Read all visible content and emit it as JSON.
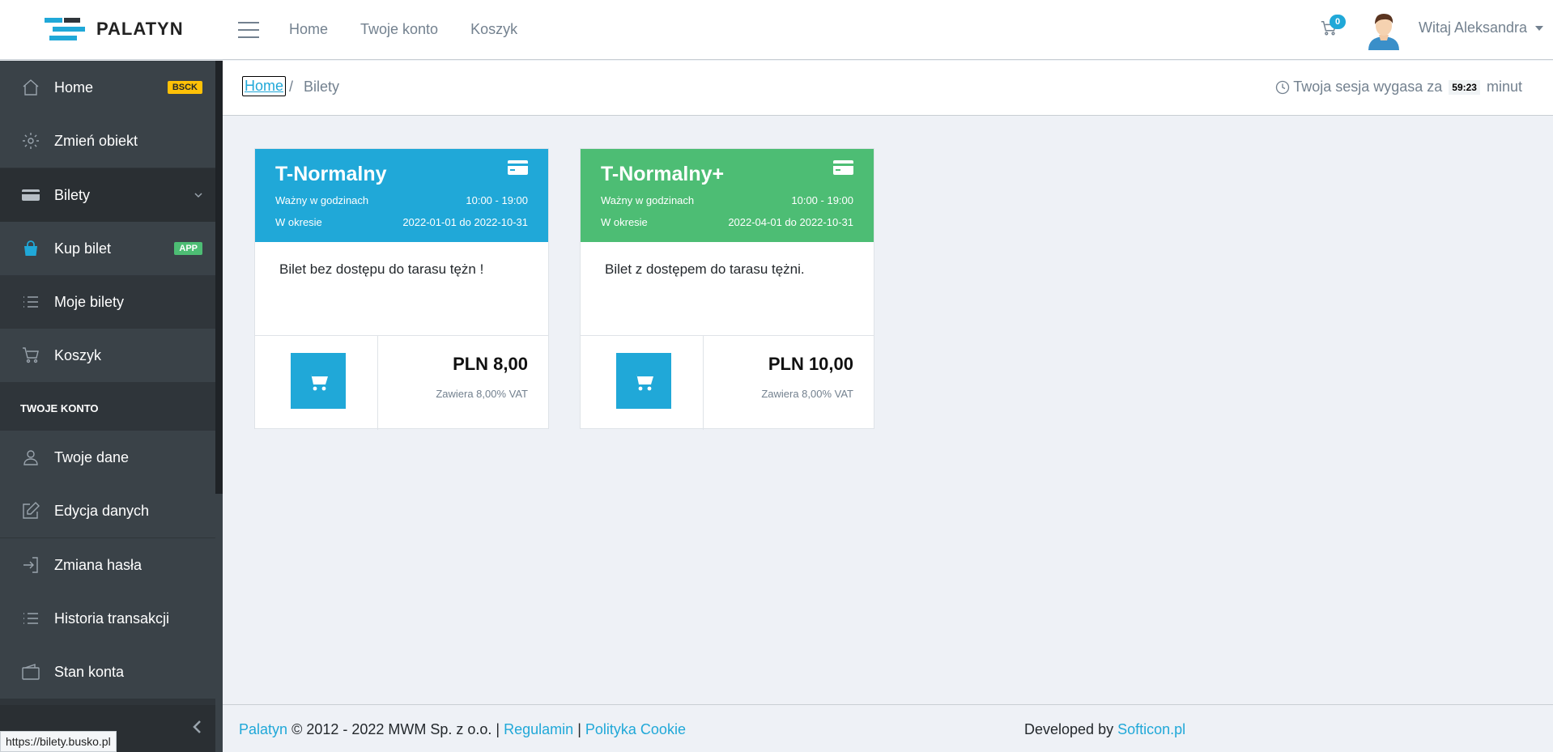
{
  "brand": {
    "name": "PALATYN"
  },
  "topnav": {
    "items": [
      "Home",
      "Twoje konto",
      "Koszyk"
    ]
  },
  "header": {
    "cart_count": "0",
    "greeting": "Witaj Aleksandra"
  },
  "sidebar": {
    "items": [
      {
        "label": "Home",
        "badge": "BSCK"
      },
      {
        "label": "Zmień obiekt"
      },
      {
        "label": "Bilety"
      },
      {
        "label": "Kup bilet",
        "badge": "APP"
      },
      {
        "label": "Moje bilety"
      },
      {
        "label": "Koszyk"
      }
    ],
    "section_title": "TWOJE KONTO",
    "account_items": [
      "Twoje dane",
      "Edycja danych",
      "Zmiana hasła",
      "Historia transakcji",
      "Stan konta"
    ]
  },
  "breadcrumb": {
    "home": "Home",
    "separator": "/",
    "current": "Bilety"
  },
  "session": {
    "text": "Twoja sesja wygasa za",
    "time": "59:23",
    "unit": "minut"
  },
  "tickets": [
    {
      "title": "T-Normalny",
      "color": "#20a8d8",
      "hours_label": "Ważny w godzinach",
      "hours": "10:00 - 19:00",
      "period_label": "W okresie",
      "period": "2022-01-01 do 2022-10-31",
      "description": "Bilet bez dostępu do tarasu tężn !",
      "price": "PLN 8,00",
      "vat": "Zawiera 8,00% VAT"
    },
    {
      "title": "T-Normalny+",
      "color": "#4dbd74",
      "hours_label": "Ważny w godzinach",
      "hours": "10:00 - 19:00",
      "period_label": "W okresie",
      "period": "2022-04-01 do 2022-10-31",
      "description": "Bilet z dostępem do tarasu tężni.",
      "price": "PLN 10,00",
      "vat": "Zawiera 8,00% VAT"
    }
  ],
  "footer": {
    "brand_link": "Palatyn",
    "copyright": "© 2012 - 2022 MWM Sp. z o.o. |",
    "regulamin": "Regulamin",
    "sep": "|",
    "cookie": "Polityka Cookie",
    "developed_by": "Developed by",
    "dev_link": "Softicon.pl"
  },
  "status_url": "https://bilety.busko.pl",
  "colors": {
    "accent": "#20a8d8",
    "green": "#4dbd74",
    "badge_yellow": "#ffc107",
    "sidebar": "#2f353a"
  }
}
